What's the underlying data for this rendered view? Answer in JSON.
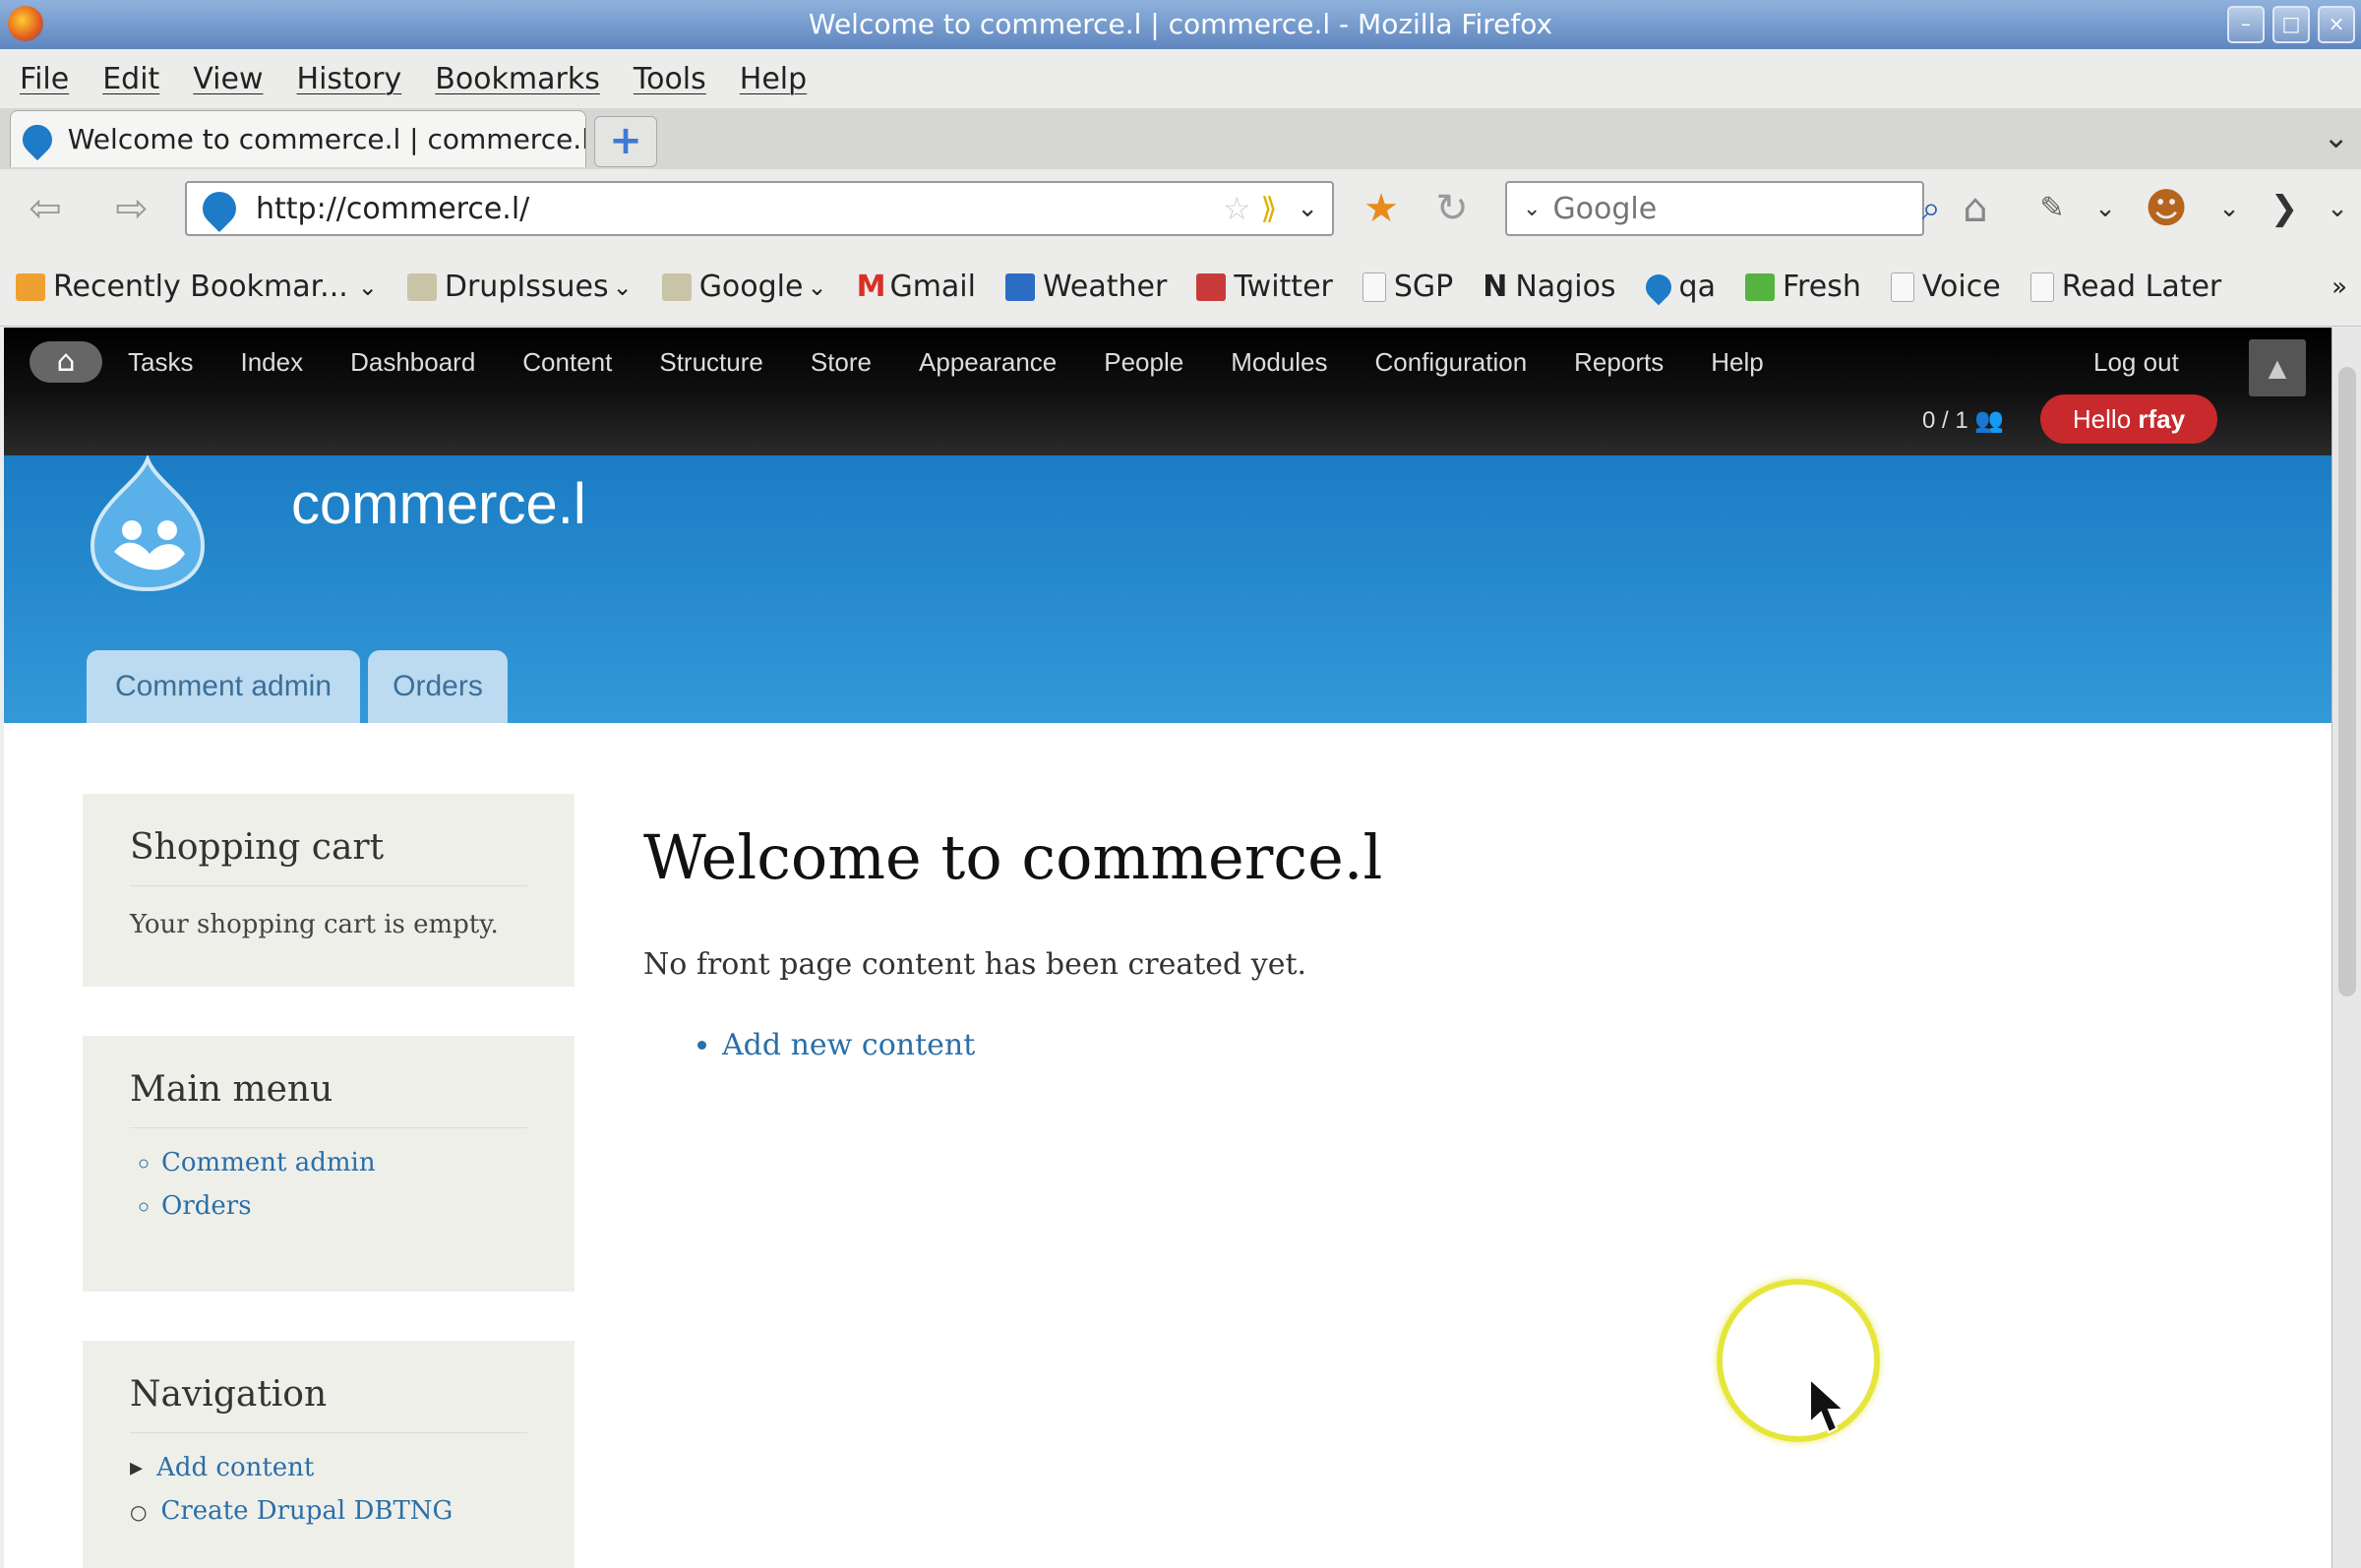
{
  "window": {
    "title": "Welcome to commerce.l | commerce.l - Mozilla Firefox"
  },
  "menubar": {
    "items": [
      "File",
      "Edit",
      "View",
      "History",
      "Bookmarks",
      "Tools",
      "Help"
    ]
  },
  "tab": {
    "title": "Welcome to commerce.l | commerce.l",
    "new_tab": "+"
  },
  "navbar": {
    "url": "http://commerce.l/",
    "search_placeholder": "Google"
  },
  "bookmarks": [
    {
      "label": "Recently Bookmar...",
      "icon": "rss-folder-icon",
      "color": "#f0a030"
    },
    {
      "label": "DrupIssues",
      "icon": "folder-icon",
      "color": "#c9c4a8"
    },
    {
      "label": "Google",
      "icon": "folder-icon",
      "color": "#c9c4a8"
    },
    {
      "label": "Gmail",
      "icon": "gmail-icon",
      "color": "#d93025"
    },
    {
      "label": "Weather",
      "icon": "weather-icon",
      "color": "#2c6cc4"
    },
    {
      "label": "Twitter",
      "icon": "twitter-icon",
      "color": "#c93b3b"
    },
    {
      "label": "SGP",
      "icon": "page-icon",
      "color": "#f4f4f4"
    },
    {
      "label": "Nagios",
      "icon": "nagios-icon",
      "color": "#111111"
    },
    {
      "label": "qa",
      "icon": "drupal-icon",
      "color": "#1d7bc7"
    },
    {
      "label": "Fresh",
      "icon": "fresh-icon",
      "color": "#55b340"
    },
    {
      "label": "Voice",
      "icon": "page-icon",
      "color": "#f4f4f4"
    },
    {
      "label": "Read Later",
      "icon": "page-icon",
      "color": "#f4f4f4"
    }
  ],
  "admin_toolbar": {
    "menu": [
      "Tasks",
      "Index",
      "Dashboard",
      "Content",
      "Structure",
      "Store",
      "Appearance",
      "People",
      "Modules",
      "Configuration",
      "Reports",
      "Help"
    ],
    "logout": "Log out",
    "user_count": "0 / 1",
    "hello_prefix": "Hello ",
    "username": "rfay"
  },
  "site": {
    "name": "commerce.l",
    "tabs": [
      "Comment admin",
      "Orders"
    ]
  },
  "sidebar": {
    "shopping_cart": {
      "title": "Shopping cart",
      "empty_text": "Your shopping cart is empty."
    },
    "main_menu": {
      "title": "Main menu",
      "items": [
        "Comment admin",
        "Orders"
      ]
    },
    "navigation": {
      "title": "Navigation",
      "items": [
        "Add content",
        "Create Drupal DBTNG"
      ]
    }
  },
  "main": {
    "title": "Welcome to commerce.l",
    "intro": "No front page content has been created yet.",
    "add_link": "Add new content"
  },
  "colors": {
    "admin_bg": "#000000",
    "header_blue": "#1b7cc4",
    "link": "#2a6fa8",
    "hello_red": "#c8292c"
  }
}
